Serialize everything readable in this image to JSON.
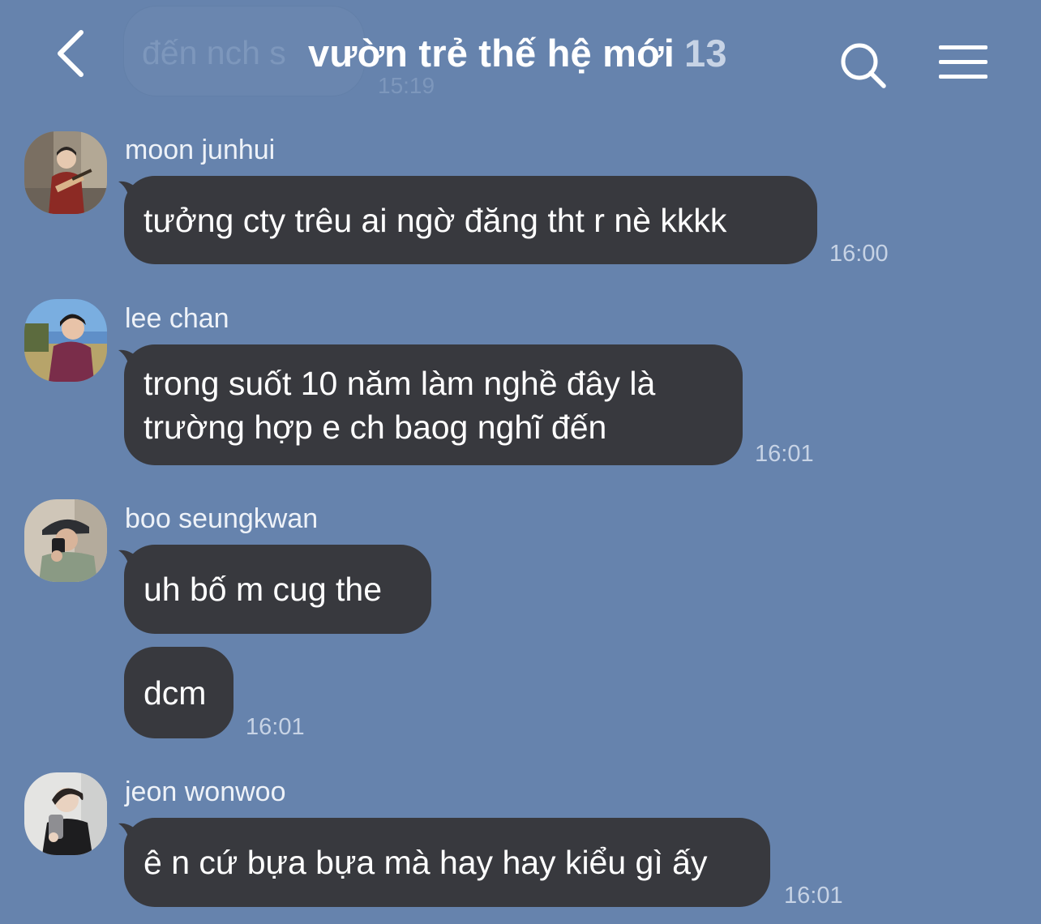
{
  "header": {
    "title": "vườn trẻ thế hệ mới",
    "member_count": "13",
    "back_icon": "chevron-left-icon",
    "search_icon": "search-icon",
    "menu_icon": "hamburger-menu-icon"
  },
  "previous_message": {
    "text": "đến nch s",
    "time": "15:19"
  },
  "messages": [
    {
      "sender": "moon junhui",
      "bubbles": [
        "tưởng cty trêu ai ngờ đăng tht r nè kkkk"
      ],
      "time": "16:00"
    },
    {
      "sender": "lee chan",
      "bubbles": [
        "trong suốt 10 năm làm nghề đây là\ntrường hợp e ch baog nghĩ đến"
      ],
      "time": "16:01"
    },
    {
      "sender": "boo seungkwan",
      "bubbles": [
        "uh bố m cug the",
        "dcm"
      ],
      "time": "16:01"
    },
    {
      "sender": "jeon wonwoo",
      "bubbles": [
        "ê n cứ bựa bựa mà hay hay kiểu gì ấy"
      ],
      "time": "16:01"
    }
  ],
  "colors": {
    "background": "#6683ad",
    "bubble": "#38393e",
    "bubble_text": "#ffffff",
    "meta_text": "#c7d3e5"
  }
}
